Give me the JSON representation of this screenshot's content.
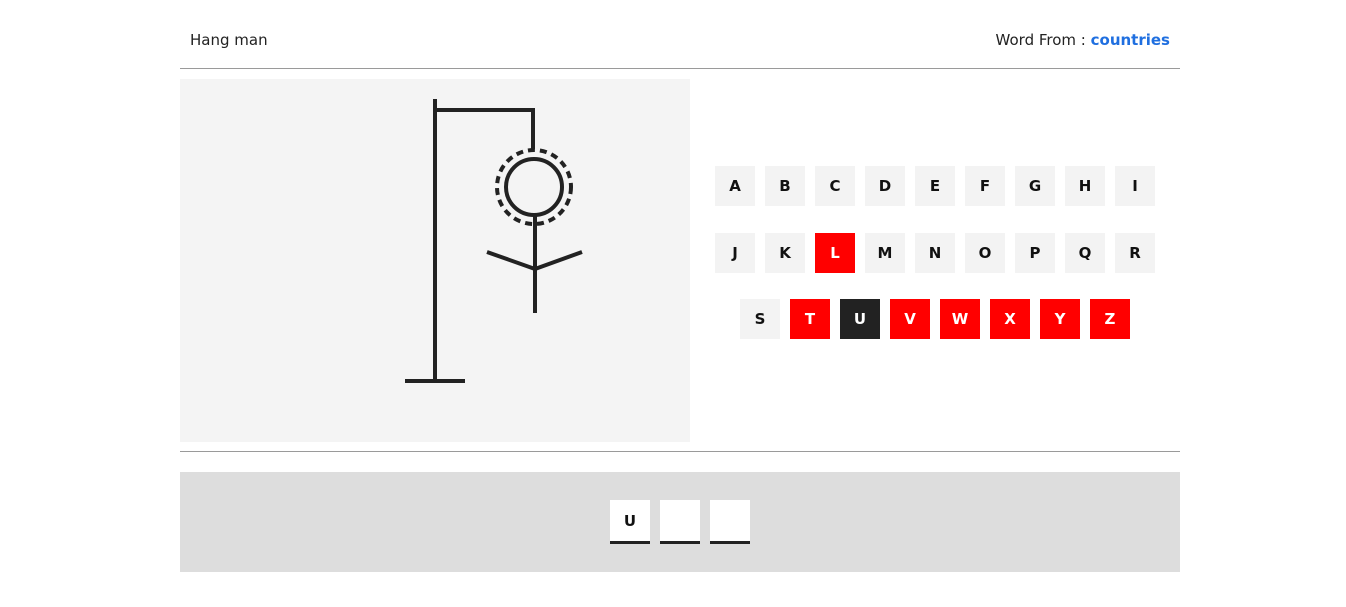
{
  "header": {
    "title": "Hang man",
    "category_label": "Word From :",
    "category_value": "countries",
    "accent_color": "#1f6fe0"
  },
  "keyboard": {
    "rows": [
      [
        {
          "letter": "A",
          "state": "unused"
        },
        {
          "letter": "B",
          "state": "unused"
        },
        {
          "letter": "C",
          "state": "unused"
        },
        {
          "letter": "D",
          "state": "unused"
        },
        {
          "letter": "E",
          "state": "unused"
        },
        {
          "letter": "F",
          "state": "unused"
        },
        {
          "letter": "G",
          "state": "unused"
        },
        {
          "letter": "H",
          "state": "unused"
        },
        {
          "letter": "I",
          "state": "unused"
        }
      ],
      [
        {
          "letter": "J",
          "state": "unused"
        },
        {
          "letter": "K",
          "state": "unused"
        },
        {
          "letter": "L",
          "state": "wrong"
        },
        {
          "letter": "M",
          "state": "unused"
        },
        {
          "letter": "N",
          "state": "unused"
        },
        {
          "letter": "O",
          "state": "unused"
        },
        {
          "letter": "P",
          "state": "unused"
        },
        {
          "letter": "Q",
          "state": "unused"
        },
        {
          "letter": "R",
          "state": "unused"
        }
      ],
      [
        {
          "letter": "S",
          "state": "unused"
        },
        {
          "letter": "T",
          "state": "wrong"
        },
        {
          "letter": "U",
          "state": "right"
        },
        {
          "letter": "V",
          "state": "wrong"
        },
        {
          "letter": "W",
          "state": "wrong"
        },
        {
          "letter": "X",
          "state": "wrong"
        },
        {
          "letter": "Y",
          "state": "wrong"
        },
        {
          "letter": "Z",
          "state": "wrong"
        }
      ]
    ],
    "colors": {
      "unused": "#f3f3f3",
      "wrong": "#ff0000",
      "right": "#222222"
    }
  },
  "hangman": {
    "parts_drawn": [
      "gallows",
      "head",
      "body",
      "arms"
    ]
  },
  "word": {
    "slots": [
      "U",
      "",
      ""
    ]
  }
}
